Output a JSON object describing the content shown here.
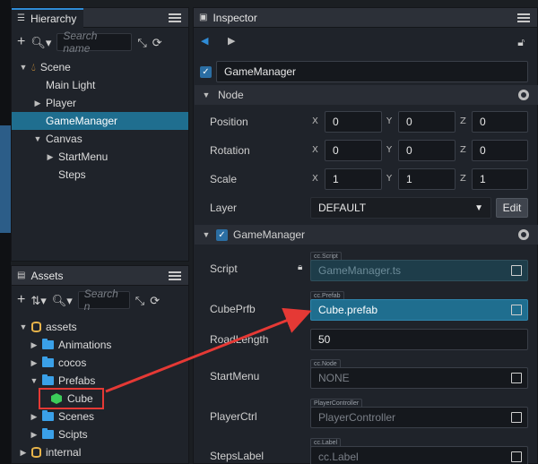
{
  "hierarchy": {
    "tab_label": "Hierarchy",
    "search_placeholder": "Search name",
    "tree": [
      {
        "label": "Scene"
      },
      {
        "label": "Main Light"
      },
      {
        "label": "Player"
      },
      {
        "label": "GameManager"
      },
      {
        "label": "Canvas"
      },
      {
        "label": "StartMenu"
      },
      {
        "label": "Steps"
      }
    ]
  },
  "assets": {
    "tab_label": "Assets",
    "search_placeholder": "Search n",
    "tree": [
      {
        "label": "assets"
      },
      {
        "label": "Animations"
      },
      {
        "label": "cocos"
      },
      {
        "label": "Prefabs"
      },
      {
        "label": "Cube"
      },
      {
        "label": "Scenes"
      },
      {
        "label": "Scipts"
      },
      {
        "label": "internal"
      }
    ]
  },
  "inspector": {
    "tab_label": "Inspector",
    "node_name": "GameManager",
    "node_section": "Node",
    "position": {
      "label": "Position",
      "x": "0",
      "y": "0",
      "z": "0"
    },
    "rotation": {
      "label": "Rotation",
      "x": "0",
      "y": "0",
      "z": "0"
    },
    "scale": {
      "label": "Scale",
      "x": "1",
      "y": "1",
      "z": "1"
    },
    "layer": {
      "label": "Layer",
      "value": "DEFAULT",
      "edit": "Edit"
    },
    "axes": {
      "x": "X",
      "y": "Y",
      "z": "Z"
    },
    "component": {
      "title": "GameManager",
      "script": {
        "label": "Script",
        "tag": "cc.Script",
        "value": "GameManager.ts"
      },
      "cube_prefab": {
        "label": "CubePrfb",
        "tag": "cc.Prefab",
        "value": "Cube.prefab"
      },
      "road_length": {
        "label": "RoadLength",
        "value": "50"
      },
      "start_menu": {
        "label": "StartMenu",
        "tag": "cc.Node",
        "value": "NONE"
      },
      "player_ctrl": {
        "label": "PlayerCtrl",
        "tag": "PlayerController",
        "value": "PlayerController"
      },
      "steps_label": {
        "label": "StepsLabel",
        "tag": "cc.Label",
        "value": "cc.Label"
      }
    }
  },
  "colors": {
    "selection": "#1f6e8f",
    "annotation": "#e53935",
    "accent": "#2f8cd6"
  }
}
